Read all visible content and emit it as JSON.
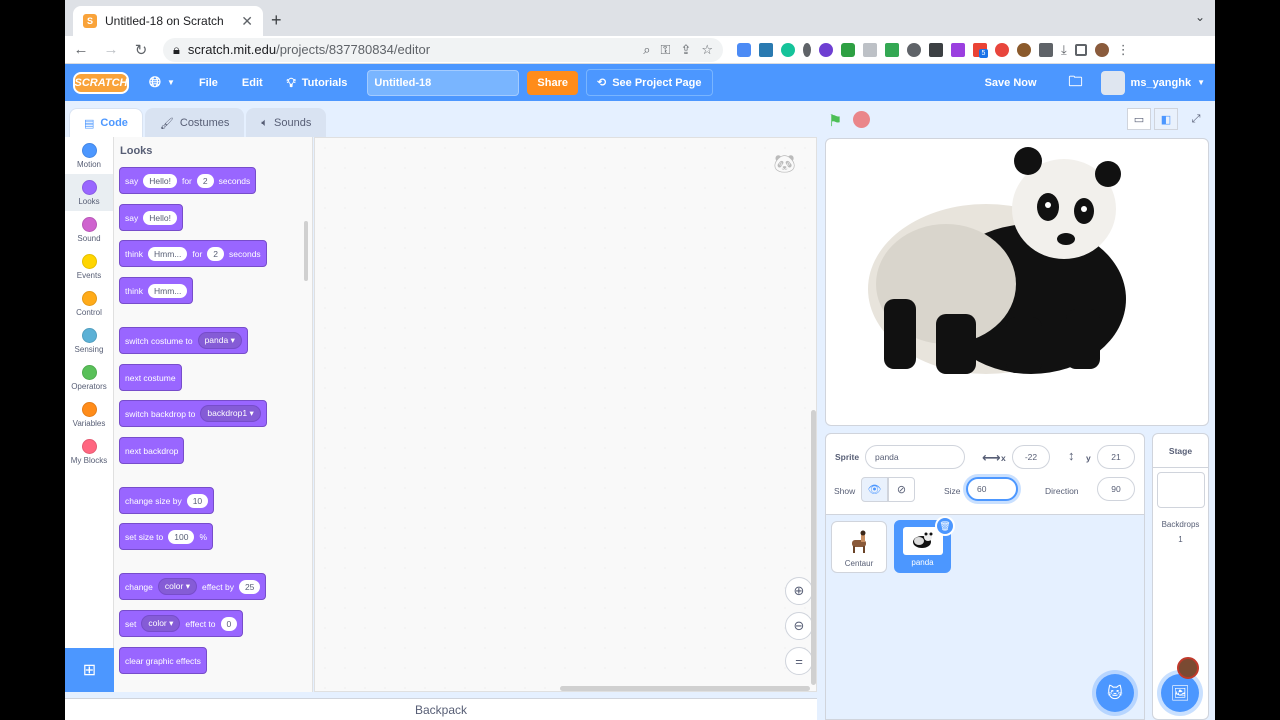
{
  "browser": {
    "tab_title": "Untitled-18 on Scratch",
    "url_host": "scratch.mit.edu",
    "url_path": "/projects/837780834/editor",
    "ext_badge": "5"
  },
  "menubar": {
    "logo": "SCRATCH",
    "file": "File",
    "edit": "Edit",
    "tutorials": "Tutorials",
    "project_title": "Untitled-18",
    "share": "Share",
    "see_project": "See Project Page",
    "save_now": "Save Now",
    "username": "ms_yanghk",
    "accent": "#4c97ff"
  },
  "editor_tabs": [
    {
      "label": "Code"
    },
    {
      "label": "Costumes"
    },
    {
      "label": "Sounds"
    }
  ],
  "categories": [
    {
      "label": "Motion",
      "color": "#4c97ff"
    },
    {
      "label": "Looks",
      "color": "#9966ff"
    },
    {
      "label": "Sound",
      "color": "#cf63cf"
    },
    {
      "label": "Events",
      "color": "#ffd500"
    },
    {
      "label": "Control",
      "color": "#ffab19"
    },
    {
      "label": "Sensing",
      "color": "#5cb1d6"
    },
    {
      "label": "Operators",
      "color": "#59c059"
    },
    {
      "label": "Variables",
      "color": "#ff8c1a"
    },
    {
      "label": "My Blocks",
      "color": "#ff6680"
    }
  ],
  "palette": {
    "title": "Looks",
    "b1": {
      "a": "say",
      "b": "Hello!",
      "c": "for",
      "d": "2",
      "e": "seconds"
    },
    "b2": {
      "a": "say",
      "b": "Hello!"
    },
    "b3": {
      "a": "think",
      "b": "Hmm...",
      "c": "for",
      "d": "2",
      "e": "seconds"
    },
    "b4": {
      "a": "think",
      "b": "Hmm..."
    },
    "b5": {
      "a": "switch costume to",
      "b": "panda"
    },
    "b6": {
      "a": "next costume"
    },
    "b7": {
      "a": "switch backdrop to",
      "b": "backdrop1"
    },
    "b8": {
      "a": "next backdrop"
    },
    "b9": {
      "a": "change size by",
      "b": "10"
    },
    "b10": {
      "a": "set size to",
      "b": "100",
      "c": "%"
    },
    "b11": {
      "a": "change",
      "b": "color",
      "c": "effect by",
      "d": "25"
    },
    "b12": {
      "a": "set",
      "b": "color",
      "c": "effect to",
      "d": "0"
    },
    "b13": {
      "a": "clear graphic effects"
    }
  },
  "backpack": "Backpack",
  "sprite_info": {
    "sprite_label": "Sprite",
    "sprite_name": "panda",
    "x_label": "x",
    "x": "-22",
    "y_label": "y",
    "y": "21",
    "show_label": "Show",
    "size_label": "Size",
    "size": "60",
    "direction_label": "Direction",
    "direction": "90"
  },
  "sprites": [
    {
      "name": "Centaur"
    },
    {
      "name": "panda"
    }
  ],
  "stage_panel": {
    "title": "Stage",
    "backdrops_label": "Backdrops",
    "backdrops_count": "1"
  }
}
